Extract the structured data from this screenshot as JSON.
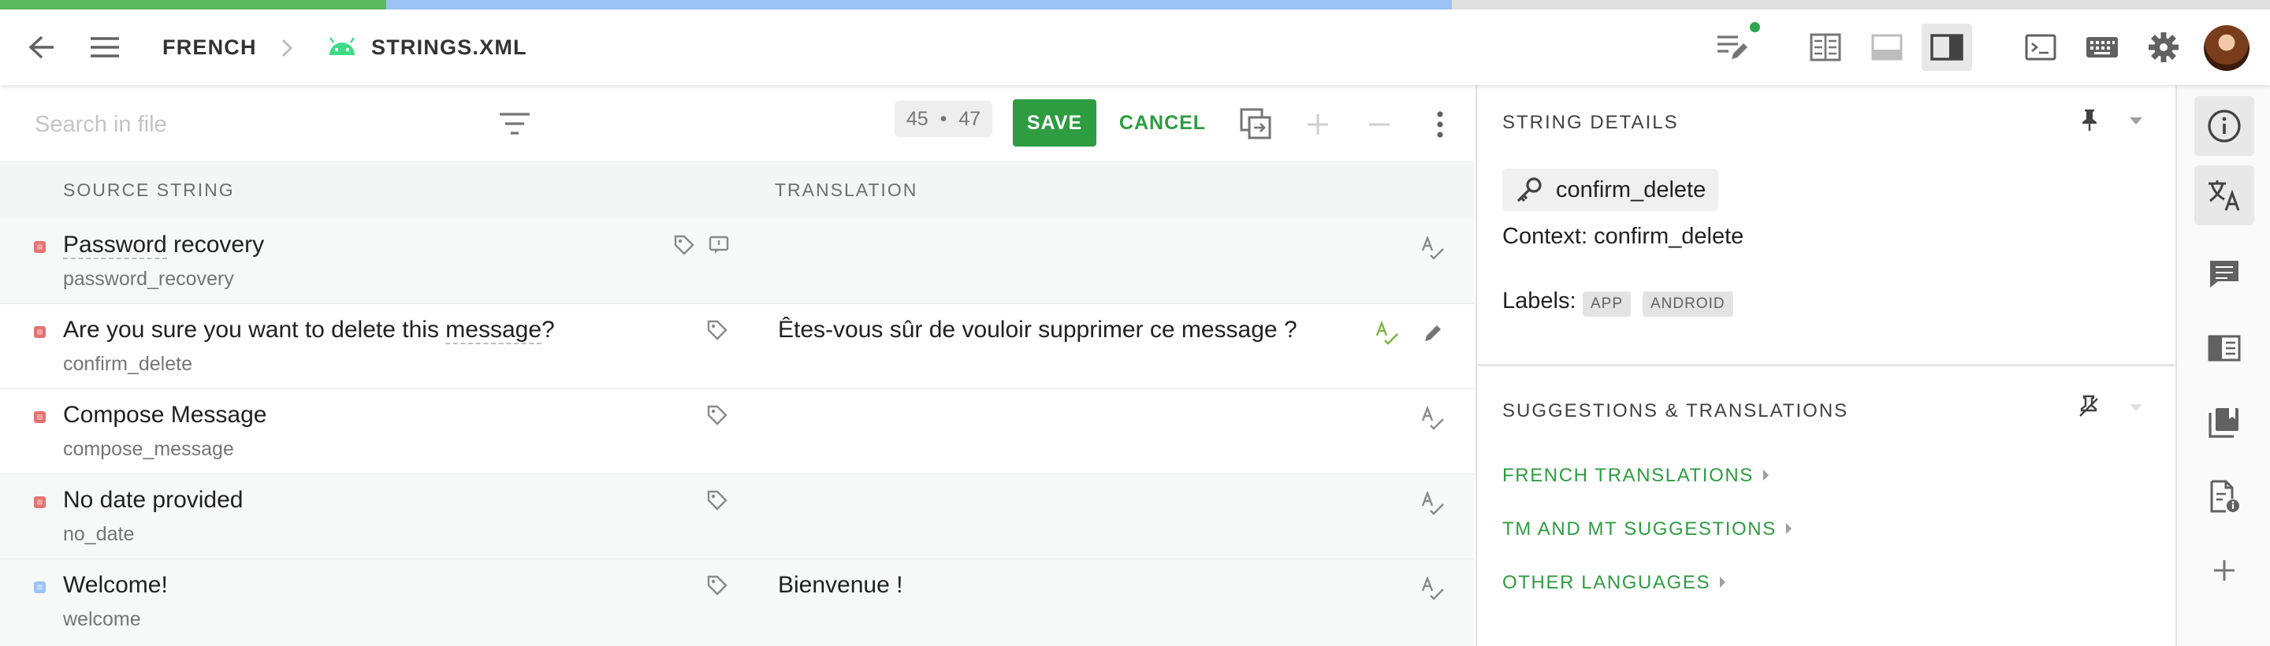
{
  "progress": {
    "translated_color": "#5cb85c",
    "fuzzy_color": "#9cc3f5",
    "untranslated_color": "#e0e0e0"
  },
  "breadcrumb": {
    "language": "FRENCH",
    "file": "STRINGS.XML"
  },
  "icons": {
    "back": "arrow-left-icon",
    "menu": "hamburger-icon",
    "android": "android-icon",
    "notes": "notes-edit-icon",
    "layout_a": "columns-icon",
    "layout_b": "rows-icon",
    "layout_c": "sidebar-layout-icon",
    "console": "terminal-icon",
    "keyboard": "keyboard-icon",
    "settings": "gear-icon"
  },
  "toolbar": {
    "search_placeholder": "Search in file",
    "counter_left": "45",
    "counter_sep": "•",
    "counter_right": "47",
    "save_label": "SAVE",
    "cancel_label": "CANCEL"
  },
  "table": {
    "headers": {
      "source": "SOURCE STRING",
      "translation": "TRANSLATION"
    },
    "rows": [
      {
        "source_pre": "Password",
        "source_post": " recovery",
        "key": "password_recovery",
        "translation": "",
        "status": "untranslated",
        "selected": false
      },
      {
        "source_pre": "Are you sure you want to delete this ",
        "source_mid": "message",
        "source_post": "?",
        "key": "confirm_delete",
        "translation": "Êtes-vous sûr de vouloir supprimer ce message ?",
        "status": "untranslated",
        "selected": true
      },
      {
        "source": "Compose Message",
        "key": "compose_message",
        "translation": "",
        "status": "untranslated",
        "selected": false
      },
      {
        "source": "No date provided",
        "key": "no_date",
        "translation": "",
        "status": "untranslated",
        "selected": false
      },
      {
        "source": "Welcome!",
        "key": "welcome",
        "translation": "Bienvenue !",
        "status": "fuzzy",
        "selected": false
      }
    ],
    "status_colors": {
      "untranslated": "#e57373",
      "fuzzy": "#9cc3f5"
    }
  },
  "details": {
    "title": "STRING DETAILS",
    "key_name": "confirm_delete",
    "context_label": "Context:",
    "context_value": "confirm_delete",
    "labels_label": "Labels:",
    "labels": [
      "APP",
      "ANDROID"
    ],
    "suggestions_title": "SUGGESTIONS & TRANSLATIONS",
    "links": [
      "FRENCH TRANSLATIONS",
      "TM AND MT SUGGESTIONS",
      "OTHER LANGUAGES"
    ]
  },
  "accent_color": "#2e9c41"
}
